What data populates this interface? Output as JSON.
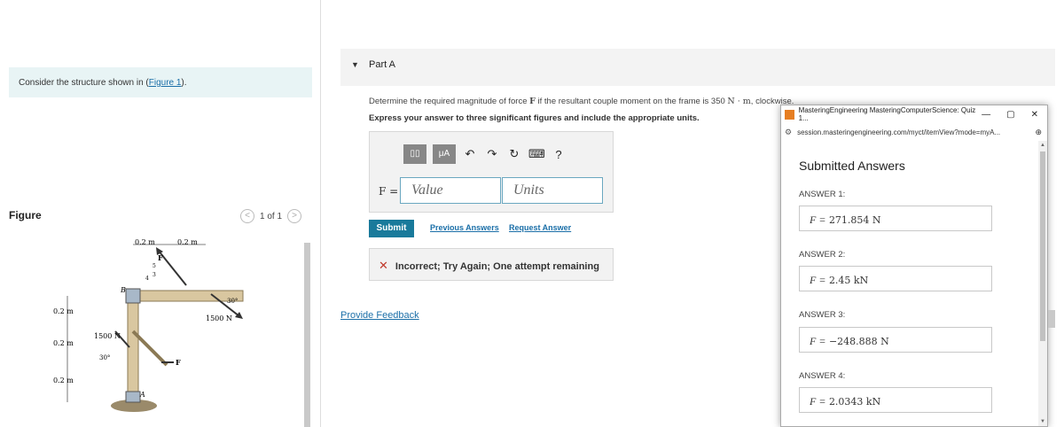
{
  "left": {
    "intro_text": "Consider the structure shown in (",
    "intro_link": "Figure 1",
    "intro_end": ").",
    "figure_label": "Figure",
    "pager": {
      "text": "1 of 1",
      "prev_icon": "chevron-left",
      "next_icon": "chevron-right"
    },
    "figure": {
      "dim_top_left": "0.2 m",
      "dim_top_right": "0.2 m",
      "dim_left": [
        "0.2 m",
        "0.2 m",
        "0.2 m"
      ],
      "label_B": "B",
      "label_A": "A",
      "label_F_top": "F",
      "label_F_mid": "F",
      "force_left": "1500 N",
      "force_right": "1500 N",
      "angle_left": "30°",
      "angle_right": "30°",
      "slope_3": "3",
      "slope_4": "4",
      "slope_5": "5"
    }
  },
  "part": {
    "title": "Part A"
  },
  "question": {
    "text_before": "Determine the required magnitude of force",
    "force_symbol": "F",
    "text_after": "if the resultant couple moment on the frame is 350",
    "units": "N · m",
    "direction": ", clockwise."
  },
  "instructions": "Express your answer to three significant figures and include the appropriate units.",
  "answer": {
    "f_label": "F =",
    "value_placeholder": "Value",
    "units_placeholder": "Units",
    "toolbar": {
      "templates_icon": "templates-icon",
      "mu_label": "μA",
      "help_label": "?"
    }
  },
  "actions": {
    "submit": "Submit",
    "previous_answers": "Previous Answers",
    "request_answer": "Request Answer"
  },
  "feedback": {
    "icon": "✕",
    "text": "Incorrect; Try Again; One attempt remaining"
  },
  "provide_feedback": "Provide Feedback",
  "popup": {
    "title": "MasteringEngineering MasteringComputerScience: Quiz 1...",
    "url": "session.masteringengineering.com/myct/itemView?mode=myA...",
    "heading": "Submitted Answers",
    "answers": [
      {
        "label": "ANSWER 1:",
        "prefix": "F =",
        "value": "271.854 N"
      },
      {
        "label": "ANSWER 2:",
        "prefix": "F =",
        "value": "2.45 kN"
      },
      {
        "label": "ANSWER 3:",
        "prefix": "F =",
        "value": "−248.888 N"
      },
      {
        "label": "ANSWER 4:",
        "prefix": "F =",
        "value": "2.0343 kN"
      }
    ]
  },
  "colors": {
    "accent": "#197a9b",
    "link": "#1b6fa8",
    "intro_bg": "#e8f4f5",
    "error": "#c0392b"
  }
}
